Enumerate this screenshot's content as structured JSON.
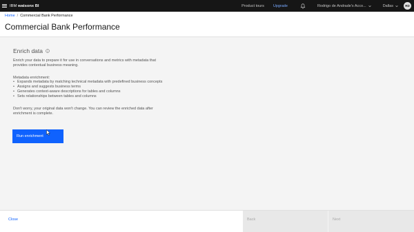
{
  "topbar": {
    "brand_prefix": "IBM",
    "brand_product": "watsonx BI",
    "product_tours": "Product tours",
    "upgrade": "Upgrade",
    "account_name": "Rodrigo de Andrade's Acco...",
    "region": "Dallas",
    "avatar_initials": "RD"
  },
  "breadcrumb": {
    "home": "Home",
    "separator": "/",
    "current": "Commercial Bank Performance"
  },
  "page": {
    "title": "Commercial Bank Performance"
  },
  "enrich": {
    "title": "Enrich data",
    "intro_line1": "Enrich your data to prepare it for use in conversations and metrics with metadata that",
    "intro_line2": "provides contextual business meaning.",
    "list_title": "Metadata enrichment:",
    "items": [
      "Expands metadata by matching technical metadata with predefined business concepts",
      "Assigns and suggests business terms",
      "Generates context-aware descriptions for tables and columns",
      "Sets relationships between tables and columns"
    ],
    "note_line1": "Don't worry, your original data won't change. You can review the enriched data after",
    "note_line2": "enrichment is complete.",
    "run_button": "Run enrichment"
  },
  "footer": {
    "close": "Close",
    "back": "Back",
    "next": "Next"
  },
  "colors": {
    "primary": "#0f62fe",
    "topbar_bg": "#161616",
    "page_bg": "#f4f4f4"
  }
}
